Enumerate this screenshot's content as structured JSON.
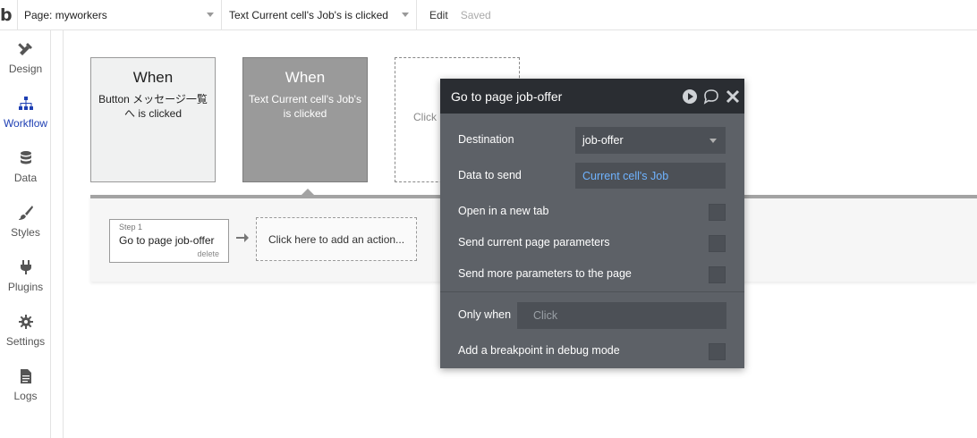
{
  "topbar": {
    "logo": "b",
    "page_select": "Page: myworkers",
    "event_select": "Text Current cell's Job's is clicked",
    "edit": "Edit",
    "saved": "Saved"
  },
  "sidebar": {
    "items": [
      {
        "label": "Design",
        "icon": "brush-ruler-icon"
      },
      {
        "label": "Workflow",
        "icon": "sitemap-icon",
        "active": true
      },
      {
        "label": "Data",
        "icon": "database-icon"
      },
      {
        "label": "Styles",
        "icon": "paint-brush-icon"
      },
      {
        "label": "Plugins",
        "icon": "plug-icon"
      },
      {
        "label": "Settings",
        "icon": "gear-icon"
      },
      {
        "label": "Logs",
        "icon": "document-icon"
      }
    ]
  },
  "events": [
    {
      "when": "When",
      "desc": "Button メッセージ一覧へ is clicked"
    },
    {
      "when": "When",
      "desc": "Text Current cell's Job's is clicked"
    },
    {
      "desc": "Click h"
    }
  ],
  "actions": {
    "step_label": "Step 1",
    "step_title": "Go to page job-offer",
    "step_delete": "delete",
    "add_action": "Click here to add an action..."
  },
  "modal": {
    "title": "Go to page job-offer",
    "destination_label": "Destination",
    "destination_value": "job-offer",
    "data_label": "Data to send",
    "data_value": "Current cell's Job",
    "new_tab_label": "Open in a new tab",
    "send_current_label": "Send current page parameters",
    "send_more_label": "Send more parameters to the page",
    "only_when_label": "Only when",
    "only_when_placeholder": "Click",
    "breakpoint_label": "Add a breakpoint in debug mode"
  },
  "colors": {
    "accent": "#1e3fb3",
    "modal_bg": "#5d6167",
    "modal_header": "#2a2d32",
    "link": "#6fb3ff"
  }
}
